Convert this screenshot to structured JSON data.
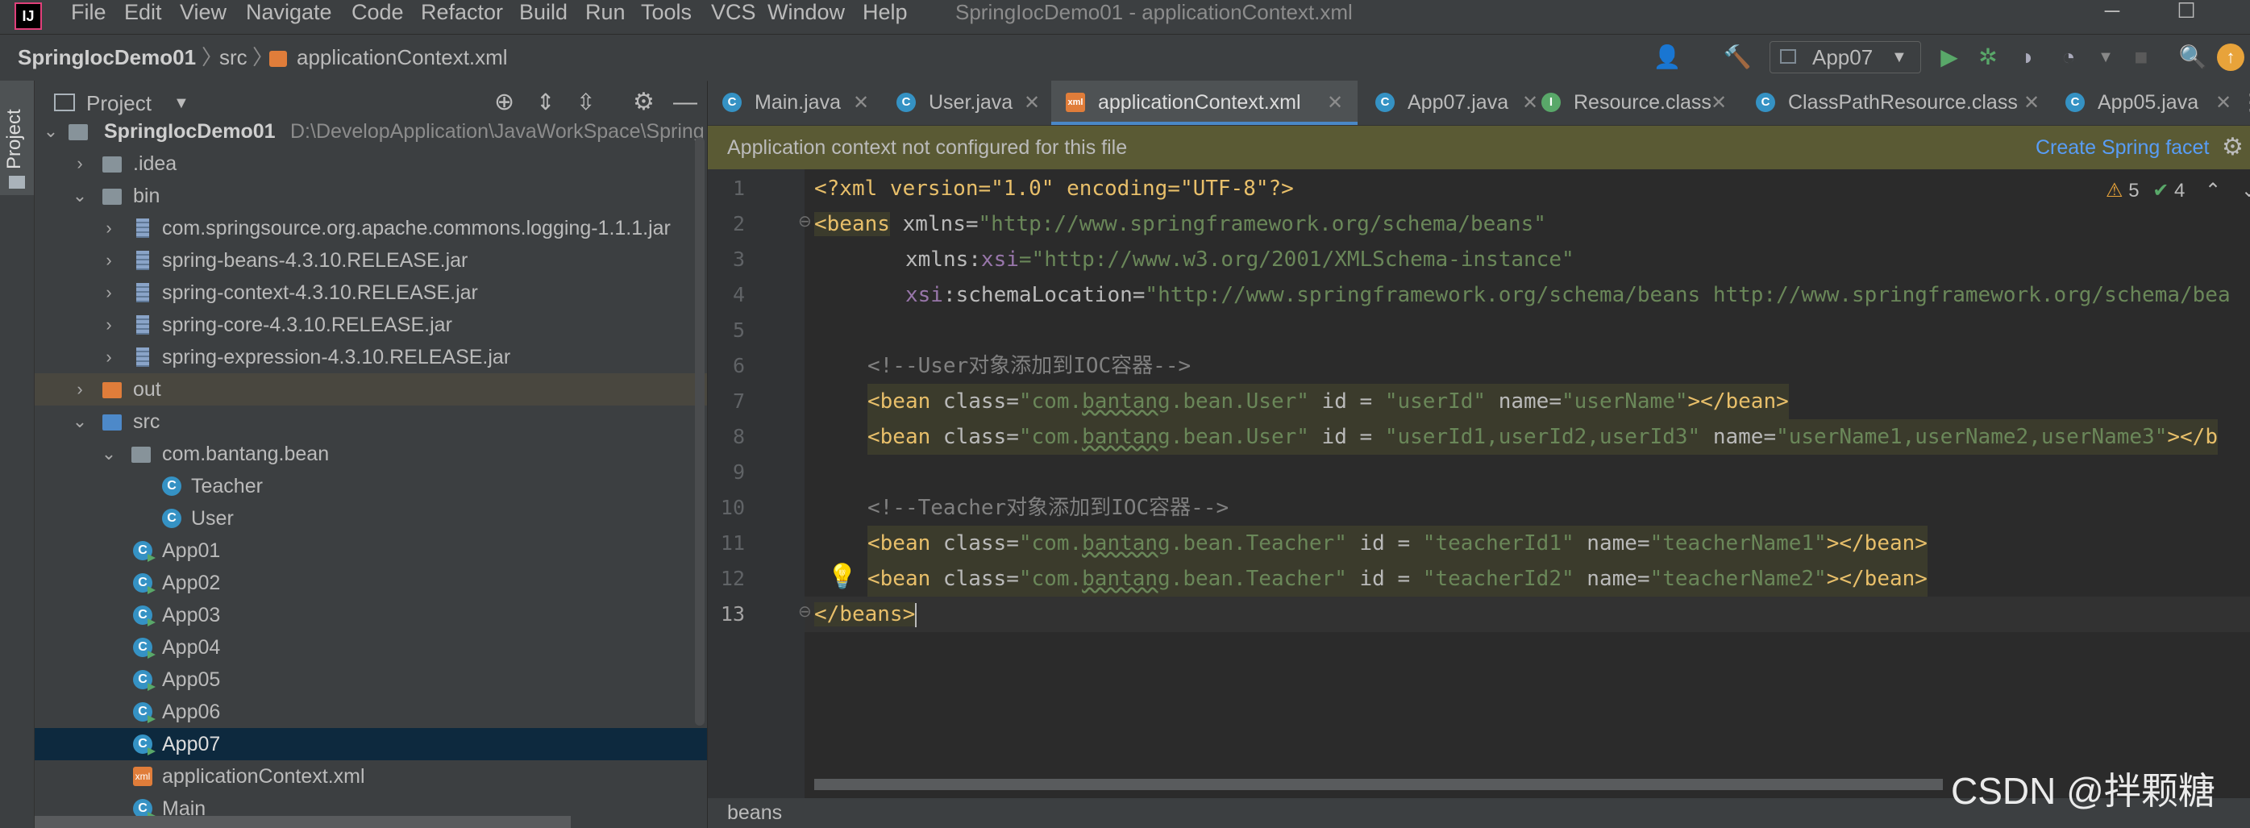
{
  "menu": {
    "items": [
      {
        "label": "File"
      },
      {
        "label": "Edit"
      },
      {
        "label": "View"
      },
      {
        "label": "Navigate"
      },
      {
        "label": "Code"
      },
      {
        "label": "Refactor"
      },
      {
        "label": "Build"
      },
      {
        "label": "Run"
      },
      {
        "label": "Tools"
      },
      {
        "label": "VCS"
      },
      {
        "label": "Window"
      },
      {
        "label": "Help"
      }
    ],
    "window_title": "SpringIocDemo01 - applicationContext.xml"
  },
  "nav": {
    "project": "SpringIocDemo01",
    "src": "src",
    "file": "applicationContext.xml",
    "run_config": "App07"
  },
  "tool_window": {
    "vertical_tab": "Project",
    "header_title": "Project"
  },
  "tree": {
    "root_name": "SpringIocDemo01",
    "root_path": "D:\\DevelopApplication\\JavaWorkSpace\\Spring",
    "idea": ".idea",
    "bin": "bin",
    "jars": [
      "com.springsource.org.apache.commons.logging-1.1.1.jar",
      "spring-beans-4.3.10.RELEASE.jar",
      "spring-context-4.3.10.RELEASE.jar",
      "spring-core-4.3.10.RELEASE.jar",
      "spring-expression-4.3.10.RELEASE.jar"
    ],
    "out": "out",
    "src": "src",
    "package": "com.bantang.bean",
    "classes": [
      "Teacher",
      "User"
    ],
    "apps": [
      "App01",
      "App02",
      "App03",
      "App04",
      "App05",
      "App06",
      "App07"
    ],
    "xml_file": "applicationContext.xml",
    "main": "Main"
  },
  "tabs": [
    {
      "label": "Main.java",
      "icon": "C"
    },
    {
      "label": "User.java",
      "icon": "C"
    },
    {
      "label": "applicationContext.xml",
      "icon": "xml"
    },
    {
      "label": "App07.java",
      "icon": "C"
    },
    {
      "label": "Resource.class",
      "icon": "I"
    },
    {
      "label": "ClassPathResource.class",
      "icon": "C"
    },
    {
      "label": "App05.java",
      "icon": "C"
    }
  ],
  "banner": {
    "message": "Application context not configured for this file",
    "action": "Create Spring facet"
  },
  "inspections": {
    "warnings": "5",
    "ok": "4"
  },
  "editor": {
    "line_numbers": [
      "1",
      "2",
      "3",
      "4",
      "5",
      "6",
      "7",
      "8",
      "9",
      "10",
      "11",
      "12",
      "13"
    ],
    "l1_pi": "<?xml version=\"1.0\" encoding=\"UTF-8\"?>",
    "l2_tag": "<beans",
    "l2_attr": " xmlns=",
    "l2_val": "\"http://www.springframework.org/schema/beans\"",
    "l3_attr": "xmlns:",
    "l3_ns": "xsi",
    "l3_val": "=\"http://www.w3.org/2001/XMLSchema-instance\"",
    "l4_ns": "xsi",
    "l4_attr": ":schemaLocation=",
    "l4_val": "\"http://www.springframework.org/schema/beans http://www.springframework.org/schema/bea",
    "l6_comment": "<!--User对象添加到IOC容器-->",
    "l7": {
      "open": "<bean",
      "a1": " class=",
      "v1a": "\"com.",
      "v1b": "bantang",
      "v1c": ".bean.User\"",
      "a2": " id = ",
      "v2": "\"userId\"",
      "a3": " name=",
      "v3": "\"userName\"",
      "close": "></bean>"
    },
    "l8": {
      "open": "<bean",
      "a1": " class=",
      "v1a": "\"com.",
      "v1b": "bantang",
      "v1c": ".bean.User\"",
      "a2": " id = ",
      "v2": "\"userId1,userId2,userId3\"",
      "a3": " name=",
      "v3": "\"userName1,userName2,userName3\"",
      "close": "></b"
    },
    "l10_comment": "<!--Teacher对象添加到IOC容器-->",
    "l11": {
      "open": "<bean",
      "a1": " class=",
      "v1a": "\"com.",
      "v1b": "bantang",
      "v1c": ".bean.Teacher\"",
      "a2": " id = ",
      "v2": "\"teacherId1\"",
      "a3": " name=",
      "v3": "\"teacherName1\"",
      "close": "></bean>"
    },
    "l12": {
      "open": "<bean",
      "a1": " class=",
      "v1a": "\"com.",
      "v1b": "bantang",
      "v1c": ".bean.Teacher\"",
      "a2": " id = ",
      "v2": "\"teacherId2\"",
      "a3": " name=",
      "v3": "\"teacherName2\"",
      "close": "></bean>"
    },
    "l13": "</beans>"
  },
  "status": {
    "breadcrumb": "beans"
  },
  "watermark": "CSDN @拌颗糖",
  "colors": {
    "tag": "#e8bf6a",
    "value": "#6a8759",
    "comment": "#808080",
    "accent": "#4a88c7",
    "banner": "#5a5a34"
  }
}
